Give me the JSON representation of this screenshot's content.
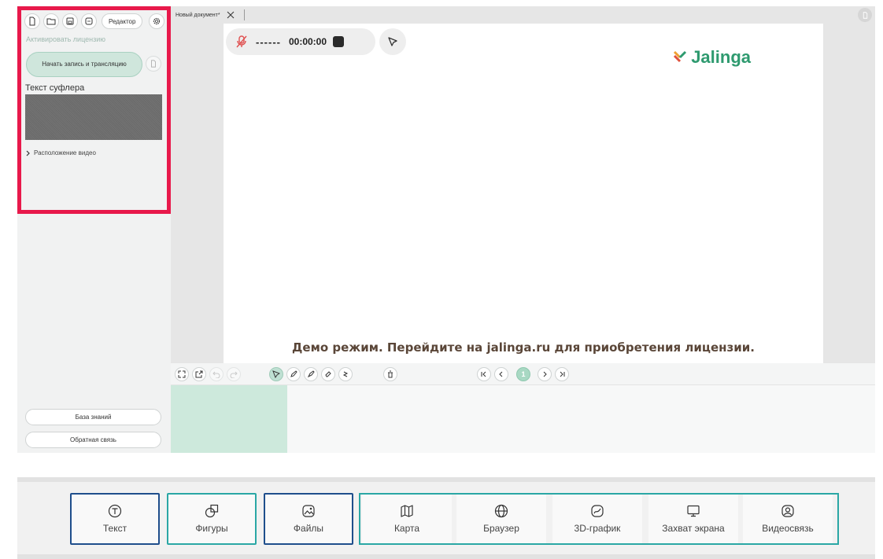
{
  "sidebar": {
    "editor_label": "Редактор",
    "activate_link": "Активировать лицензию",
    "start_button": "Начать запись и трансляцию",
    "prompter_label": "Текст суфлера",
    "video_position": "Расположение видео",
    "knowledge_base": "База знаний",
    "feedback": "Обратная связь"
  },
  "tabs": [
    {
      "label": "Новый документ*"
    }
  ],
  "recorder": {
    "status": "------",
    "time": "00:00:00"
  },
  "logo": {
    "text": "Jalinga"
  },
  "demo_notice": "Демо режим. Перейдите на jalinga.ru для приобретения лицензии.",
  "pagination": {
    "current": "1"
  },
  "tools": [
    {
      "label": "Текст",
      "icon": "text-icon"
    },
    {
      "label": "Фигуры",
      "icon": "shapes-icon"
    },
    {
      "label": "Файлы",
      "icon": "files-icon"
    },
    {
      "label": "Карта",
      "icon": "map-icon"
    },
    {
      "label": "Браузер",
      "icon": "globe-icon"
    },
    {
      "label": "3D-график",
      "icon": "graph-icon"
    },
    {
      "label": "Захват экрана",
      "icon": "monitor-icon"
    },
    {
      "label": "Видеосвязь",
      "icon": "user-icon"
    }
  ],
  "colors": {
    "accent": "#2e9a6f",
    "highlight_red": "#e8194b",
    "highlight_blue": "#1f4e8c",
    "highlight_teal": "#2aa7a5"
  }
}
